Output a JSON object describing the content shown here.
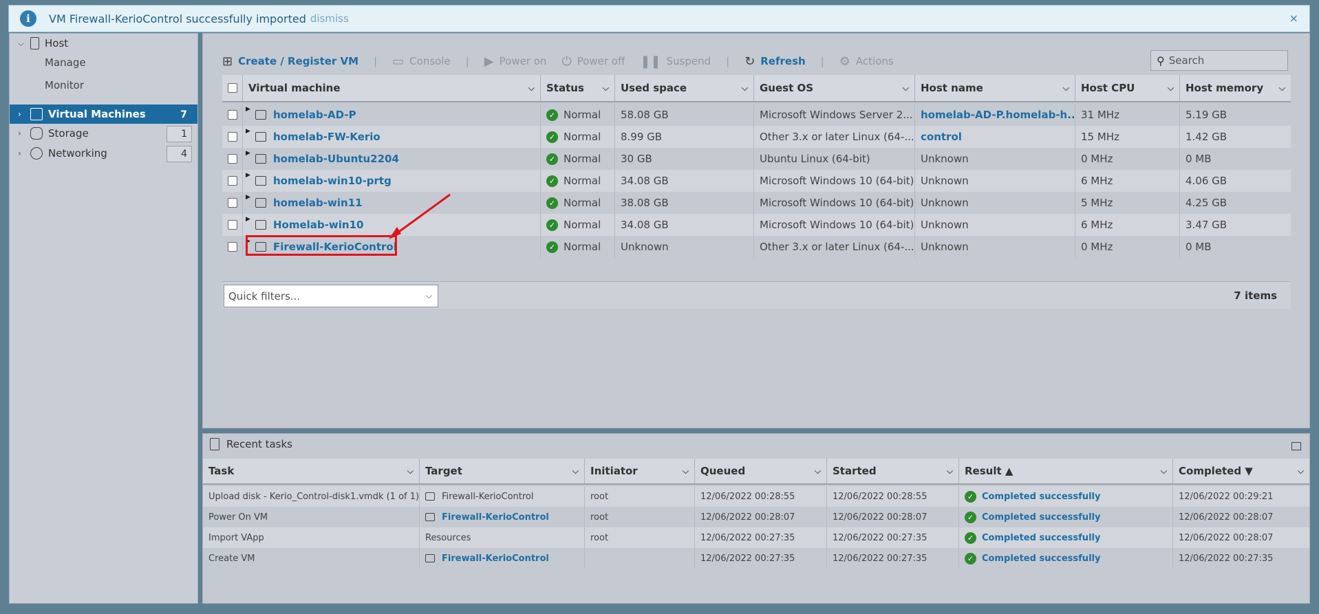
{
  "notification": {
    "message": "VM Firewall-KerioControl successfully imported",
    "dismiss": "dismiss",
    "close": "×"
  },
  "sidebar": {
    "host": "Host",
    "manage": "Manage",
    "monitor": "Monitor",
    "items": [
      {
        "label": "Virtual Machines",
        "count": "7"
      },
      {
        "label": "Storage",
        "count": "1"
      },
      {
        "label": "Networking",
        "count": "4"
      }
    ]
  },
  "toolbar": {
    "create": "Create / Register VM",
    "console": "Console",
    "power_on": "Power on",
    "power_off": "Power off",
    "suspend": "Suspend",
    "refresh": "Refresh",
    "actions": "Actions",
    "search_placeholder": "Search"
  },
  "vm_table": {
    "columns": [
      "Virtual machine",
      "Status",
      "Used space",
      "Guest OS",
      "Host name",
      "Host CPU",
      "Host memory"
    ],
    "rows": [
      {
        "name": "homelab-AD-P",
        "status": "Normal",
        "used": "58.08 GB",
        "os": "Microsoft Windows Server 2...",
        "host": "homelab-AD-P.homelab-h...",
        "cpu": "31 MHz",
        "mem": "5.19 GB"
      },
      {
        "name": "homelab-FW-Kerio",
        "status": "Normal",
        "used": "8.99 GB",
        "os": "Other 3.x or later Linux (64-...",
        "host": "control",
        "cpu": "15 MHz",
        "mem": "1.42 GB"
      },
      {
        "name": "homelab-Ubuntu2204",
        "status": "Normal",
        "used": "30 GB",
        "os": "Ubuntu Linux (64-bit)",
        "host": "Unknown",
        "cpu": "0 MHz",
        "mem": "0 MB"
      },
      {
        "name": "homelab-win10-prtg",
        "status": "Normal",
        "used": "34.08 GB",
        "os": "Microsoft Windows 10 (64-bit)",
        "host": "Unknown",
        "cpu": "6 MHz",
        "mem": "4.06 GB"
      },
      {
        "name": "homelab-win11",
        "status": "Normal",
        "used": "38.08 GB",
        "os": "Microsoft Windows 10 (64-bit)",
        "host": "Unknown",
        "cpu": "5 MHz",
        "mem": "4.25 GB"
      },
      {
        "name": "Homelab-win10",
        "status": "Normal",
        "used": "34.08 GB",
        "os": "Microsoft Windows 10 (64-bit)",
        "host": "Unknown",
        "cpu": "6 MHz",
        "mem": "3.47 GB"
      },
      {
        "name": "Firewall-KerioControl",
        "status": "Normal",
        "used": "Unknown",
        "os": "Other 3.x or later Linux (64-...",
        "host": "Unknown",
        "cpu": "0 MHz",
        "mem": "0 MB"
      }
    ],
    "quick_filters": "Quick filters...",
    "item_count": "7 items"
  },
  "tasks": {
    "title": "Recent tasks",
    "columns": [
      "Task",
      "Target",
      "Initiator",
      "Queued",
      "Started",
      "Result ▲",
      "Completed ▼"
    ],
    "rows": [
      {
        "task": "Upload disk - Kerio_Control-disk1.vmdk (1 of 1)",
        "target": "Firewall-KerioControl",
        "initiator": "root",
        "queued": "12/06/2022 00:28:55",
        "started": "12/06/2022 00:28:55",
        "result": "Completed successfully",
        "completed": "12/06/2022 00:29:21"
      },
      {
        "task": "Power On VM",
        "target": "Firewall-KerioControl",
        "initiator": "root",
        "queued": "12/06/2022 00:28:07",
        "started": "12/06/2022 00:28:07",
        "result": "Completed successfully",
        "completed": "12/06/2022 00:28:07"
      },
      {
        "task": "Import VApp",
        "target": "Resources",
        "initiator": "root",
        "queued": "12/06/2022 00:27:35",
        "started": "12/06/2022 00:27:35",
        "result": "Completed successfully",
        "completed": "12/06/2022 00:28:07"
      },
      {
        "task": "Create VM",
        "target": "Firewall-KerioControl",
        "initiator": "",
        "queued": "12/06/2022 00:27:35",
        "started": "12/06/2022 00:27:35",
        "result": "Completed successfully",
        "completed": "12/06/2022 00:27:35"
      }
    ]
  },
  "colors": {
    "accent": "#1b6ba0",
    "link": "#1f6ea3",
    "success": "#2e8a2e",
    "highlight": "#e2141a"
  }
}
